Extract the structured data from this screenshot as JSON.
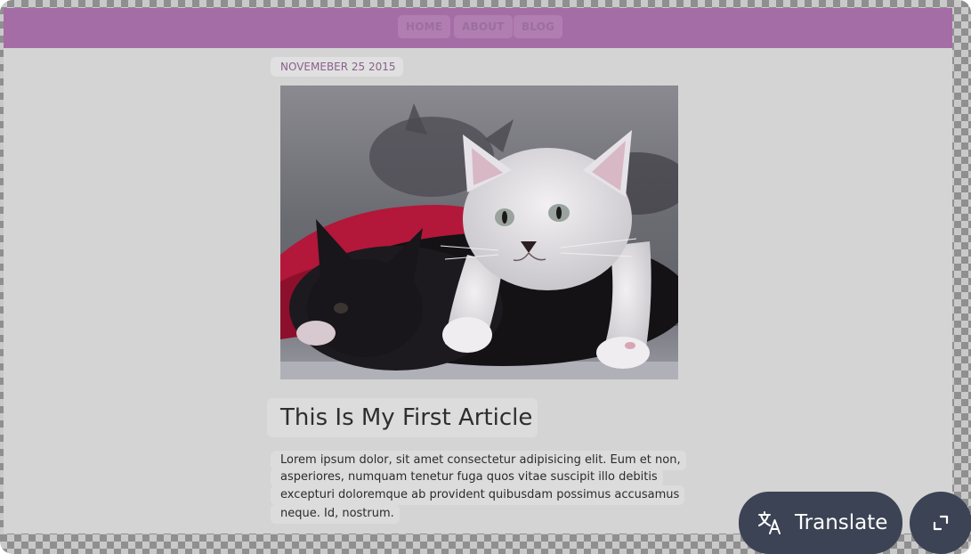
{
  "nav": {
    "items": [
      {
        "label": "HOME"
      },
      {
        "label": "ABOUT"
      },
      {
        "label": "BLOG"
      }
    ]
  },
  "article": {
    "date": "NOVEMEBER 25 2015",
    "image_alt": "two kittens",
    "title": "This Is My First Article",
    "body_lines": [
      "Lorem ipsum dolor, sit amet consectetur adipisicing elit. Eum et non,",
      "asperiores, numquam tenetur fuga quos vitae suscipit illo debitis",
      "excepturi doloremque ab provident quibusdam possimus accusamus",
      "neque. Id, nostrum."
    ]
  },
  "overlay": {
    "translate_label": "Translate",
    "translate_icon": "translate-icon",
    "expand_icon": "expand-icon"
  },
  "colors": {
    "navbar": "#a56da6",
    "page_background": "#d4d4d4",
    "overlay_button": "#3b4354"
  }
}
